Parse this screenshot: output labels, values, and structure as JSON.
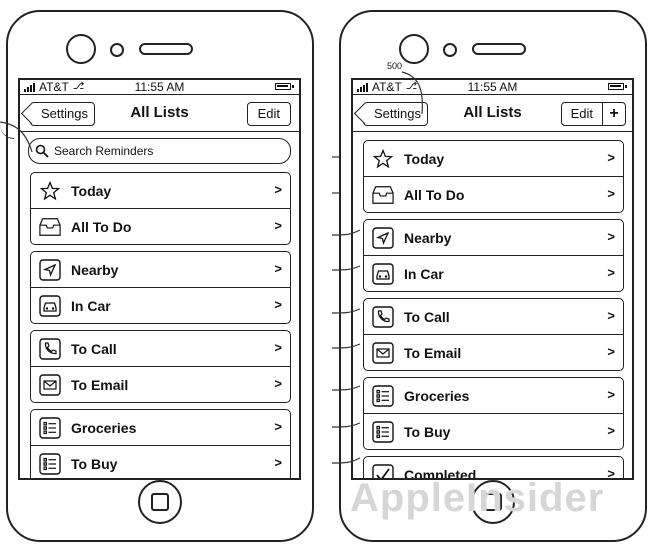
{
  "left_screen": {
    "status": {
      "carrier": "AT&T",
      "time": "11:55 AM"
    },
    "nav": {
      "back_label": "Settings",
      "title": "All Lists",
      "edit_label": "Edit"
    },
    "search": {
      "placeholder": "Search Reminders"
    },
    "groups": [
      [
        {
          "icon": "star-icon",
          "label": "Today"
        },
        {
          "icon": "inbox-tray-icon",
          "label": "All To Do"
        }
      ],
      [
        {
          "icon": "location-arrow-icon",
          "label": "Nearby"
        },
        {
          "icon": "car-icon",
          "label": "In Car"
        }
      ],
      [
        {
          "icon": "phone-icon",
          "label": "To Call"
        },
        {
          "icon": "envelope-icon",
          "label": "To Email"
        }
      ],
      [
        {
          "icon": "list-icon",
          "label": "Groceries"
        },
        {
          "icon": "list-icon",
          "label": "To Buy"
        }
      ]
    ]
  },
  "right_screen": {
    "status": {
      "carrier": "AT&T",
      "time": "11:55 AM"
    },
    "nav": {
      "back_label": "Settings",
      "title": "All Lists",
      "edit_label": "Edit",
      "add_label": "+"
    },
    "groups": [
      [
        {
          "icon": "star-icon",
          "label": "Today"
        },
        {
          "icon": "inbox-tray-icon",
          "label": "All To Do"
        }
      ],
      [
        {
          "icon": "location-arrow-icon",
          "label": "Nearby"
        },
        {
          "icon": "car-icon",
          "label": "In Car"
        }
      ],
      [
        {
          "icon": "phone-icon",
          "label": "To Call"
        },
        {
          "icon": "envelope-icon",
          "label": "To Email"
        }
      ],
      [
        {
          "icon": "list-icon",
          "label": "Groceries"
        },
        {
          "icon": "list-icon",
          "label": "To Buy"
        }
      ],
      [
        {
          "icon": "checkmark-icon",
          "label": "Completed"
        }
      ]
    ]
  },
  "annotation": {
    "reference_number": "500"
  },
  "watermark": "AppleInsider",
  "chevron": ">"
}
